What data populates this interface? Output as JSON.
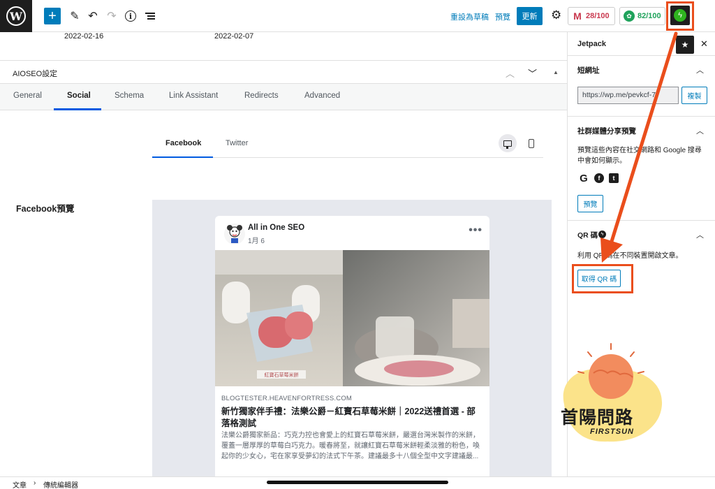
{
  "topbar": {
    "wp_logo": "W",
    "add_icon": "+",
    "tools_icon": "✎",
    "undo_icon": "↶",
    "redo_icon": "↷",
    "info_icon": "i",
    "switch_to_draft": "重設為草稿",
    "preview": "預覽",
    "update": "更新",
    "settings_icon": "⚙",
    "scores": [
      {
        "label": "28/100",
        "icon": "M",
        "color": "#c9384e"
      },
      {
        "label": "82/100",
        "icon": "✿",
        "color": "#1fa25b"
      }
    ],
    "jetpack_icon": "ϟ"
  },
  "post": {
    "dates": [
      "2022-02-16",
      "2022-02-07"
    ]
  },
  "aioseo": {
    "title": "AIOSEO設定",
    "ctrl_up": "︿",
    "ctrl_down": "﹀",
    "ctrl_move": "▲",
    "tabs": [
      "General",
      "Social",
      "Schema",
      "Link Assistant",
      "Redirects",
      "Advanced"
    ],
    "active_tab": "Social",
    "subtabs": [
      "Facebook",
      "Twitter"
    ],
    "active_subtab": "Facebook",
    "section_label": "Facebook預覽"
  },
  "fb_preview": {
    "page_name": "All in One SEO",
    "post_date": "1月 6",
    "dots": "•••",
    "image_caption": "紅寶石草莓米餅",
    "domain": "BLOGTESTER.HEAVENFORTRESS.COM",
    "title": "新竹獨家伴手禮：法樂公爵－紅寶石草莓米餅｜2022送禮首選 - 部落格測試",
    "description": "法樂公爵獨家新品：巧克力控也會愛上的紅寶石草莓米餅，嚴選台灣米製作的米餅，覆蓋一層厚厚的草莓白巧克力。暖春將至，就讓紅寶石草莓米餅輕柔淡雅的粉色，喚起你的少女心，宅在家享受夢幻的法式下午茶。建議最多十八個全型中文字建議最..."
  },
  "sidebar": {
    "title": "Jetpack",
    "star_icon": "★",
    "close_icon": "✕",
    "chevron": "︿",
    "shortlink": {
      "title": "短網址",
      "value": "https://wp.me/pevkcf-7",
      "copy": "複製"
    },
    "social": {
      "title": "社群媒體分享預覽",
      "text": "預覽這些內容在社交網路和 Google 搜尋中會如何顯示。",
      "icons": [
        {
          "name": "google-icon",
          "glyph": "G"
        },
        {
          "name": "facebook-icon",
          "glyph": "f"
        },
        {
          "name": "tumblr-icon",
          "glyph": "t"
        }
      ],
      "preview_btn": "預覽"
    },
    "qr": {
      "title": "QR 碼",
      "bolt": "ϟ",
      "text": "利用 QR 碼在不同裝置開啟文章。",
      "button": "取得 QR 碼"
    }
  },
  "footer": {
    "crumbs": [
      "文章",
      "傳統編輯器"
    ],
    "separator": "›"
  },
  "watermark": {
    "text": "首陽問路",
    "sub": "FIRSTSUN"
  },
  "colors": {
    "accent": "#007cba",
    "annotation": "#ea4e1c",
    "jetpack": "#2fb41f"
  }
}
